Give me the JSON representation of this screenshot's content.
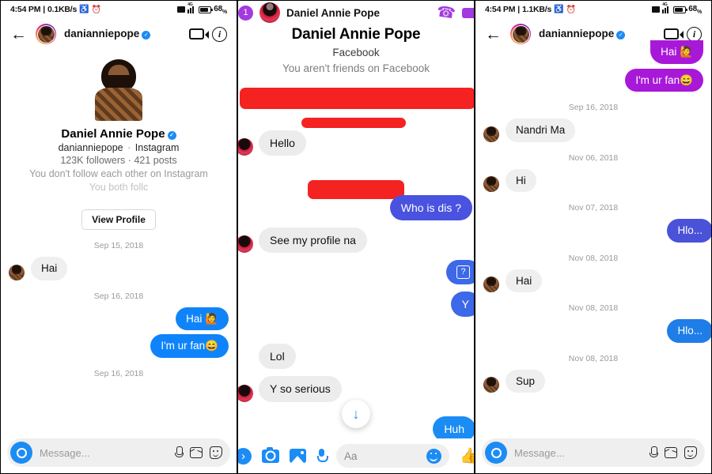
{
  "panel1": {
    "statusbar": {
      "time": "4:54 PM",
      "separator": "|",
      "datarate": "0.1KB/s",
      "mute_icon": "mute-icon",
      "alarm_icon": "alarm-icon",
      "sim_icon": "sim-card-icon",
      "network": "4G",
      "signal_icon": "signal-bars-icon",
      "battery_icon": "battery-icon",
      "battery_pct": "68",
      "battery_unit": "%"
    },
    "header": {
      "back_icon": "back-arrow-icon",
      "avatar": "profile-avatar",
      "username": "danianniepope",
      "verified_icon": "verified-badge-icon",
      "video_icon": "video-call-icon",
      "info_icon": "info-icon"
    },
    "profile": {
      "name": "Daniel Annie Pope",
      "verified_icon": "verified-badge-icon",
      "handle": "danianniepope",
      "dot": "·",
      "platform": "Instagram",
      "followers": "123K followers",
      "posts": "421 posts",
      "note": "You don't follow each other on Instagram",
      "note2": "You both follc",
      "view_profile_label": "View Profile"
    },
    "messages": [
      {
        "type": "date",
        "text": "Sep 15, 2018"
      },
      {
        "type": "in",
        "text": "Hai"
      },
      {
        "type": "date",
        "text": "Sep 16, 2018"
      },
      {
        "type": "out",
        "text": "Hai 🙋",
        "color": "#0f84fa"
      },
      {
        "type": "out",
        "text": "I'm ur fan😄",
        "color": "#0f84fa"
      },
      {
        "type": "date",
        "text": "Sep 16, 2018"
      }
    ],
    "composer": {
      "camera_icon": "camera-icon",
      "placeholder": "Message...",
      "mic_icon": "microphone-icon",
      "gallery_icon": "gallery-icon",
      "sticker_icon": "sticker-icon"
    }
  },
  "panel2": {
    "topbar": {
      "badge": "1",
      "avatar": "contact-avatar",
      "name": "Daniel Annie Pope",
      "phone_icon": "phone-call-icon",
      "video_icon": "video-call-icon"
    },
    "profile": {
      "name": "Daniel Annie Pope",
      "platform": "Facebook",
      "not_friends": "You aren't friends on Facebook"
    },
    "redactions": 3,
    "messages": [
      {
        "type": "in",
        "text": "Hello"
      },
      {
        "type": "out",
        "text": "Who is dis ?",
        "color": "#4a52e0"
      },
      {
        "type": "in",
        "text": "See my profile na"
      },
      {
        "type": "out",
        "text": "?",
        "icon": true,
        "color": "#3d68e8"
      },
      {
        "type": "out",
        "text": "Y",
        "color": "#3d68e8"
      },
      {
        "type": "in",
        "text": "Lol"
      },
      {
        "type": "in",
        "text": "Y so serious"
      },
      {
        "type": "out",
        "text": "Huh",
        "color": "#1c8cf5"
      }
    ],
    "scroll_down_icon": "scroll-to-bottom-arrow-icon",
    "composer": {
      "plus_icon": "add-icon",
      "camera_icon": "camera-icon",
      "gallery_icon": "gallery-icon",
      "mic_icon": "microphone-icon",
      "placeholder": "Aa",
      "emoji_icon": "emoji-smiley-icon",
      "thumbs_up_icon": "thumbs-up-icon"
    }
  },
  "panel3": {
    "statusbar": {
      "time": "4:54 PM",
      "separator": "|",
      "datarate": "1.1KB/s",
      "mute_icon": "mute-icon",
      "alarm_icon": "alarm-icon",
      "sim_icon": "sim-card-icon",
      "network": "4G",
      "signal_icon": "signal-bars-icon",
      "battery_icon": "battery-icon",
      "battery_pct": "68",
      "battery_unit": "%"
    },
    "header": {
      "back_icon": "back-arrow-icon",
      "avatar": "profile-avatar",
      "username": "danianniepope",
      "verified_icon": "verified-badge-icon",
      "video_icon": "video-call-icon",
      "info_icon": "info-icon"
    },
    "messages": [
      {
        "type": "out",
        "text": "Hai 🙋",
        "color": "#a818d8",
        "clipped": true
      },
      {
        "type": "out",
        "text": "I'm ur fan😄",
        "color": "#a818d8"
      },
      {
        "type": "date",
        "text": "Sep 16, 2018"
      },
      {
        "type": "in",
        "text": "Nandri Ma"
      },
      {
        "type": "date",
        "text": "Nov 06, 2018"
      },
      {
        "type": "in",
        "text": "Hi"
      },
      {
        "type": "date",
        "text": "Nov 07, 2018"
      },
      {
        "type": "out",
        "text": "Hlo...",
        "color": "#4a52d8"
      },
      {
        "type": "date",
        "text": "Nov 08, 2018"
      },
      {
        "type": "in",
        "text": "Hai"
      },
      {
        "type": "date",
        "text": "Nov 08, 2018"
      },
      {
        "type": "out",
        "text": "Hlo...",
        "color": "#1f7de8"
      },
      {
        "type": "date",
        "text": "Nov 08, 2018"
      },
      {
        "type": "in",
        "text": "Sup"
      }
    ],
    "composer": {
      "camera_icon": "camera-icon",
      "placeholder": "Message...",
      "mic_icon": "microphone-icon",
      "gallery_icon": "gallery-icon",
      "sticker_icon": "sticker-icon"
    }
  }
}
